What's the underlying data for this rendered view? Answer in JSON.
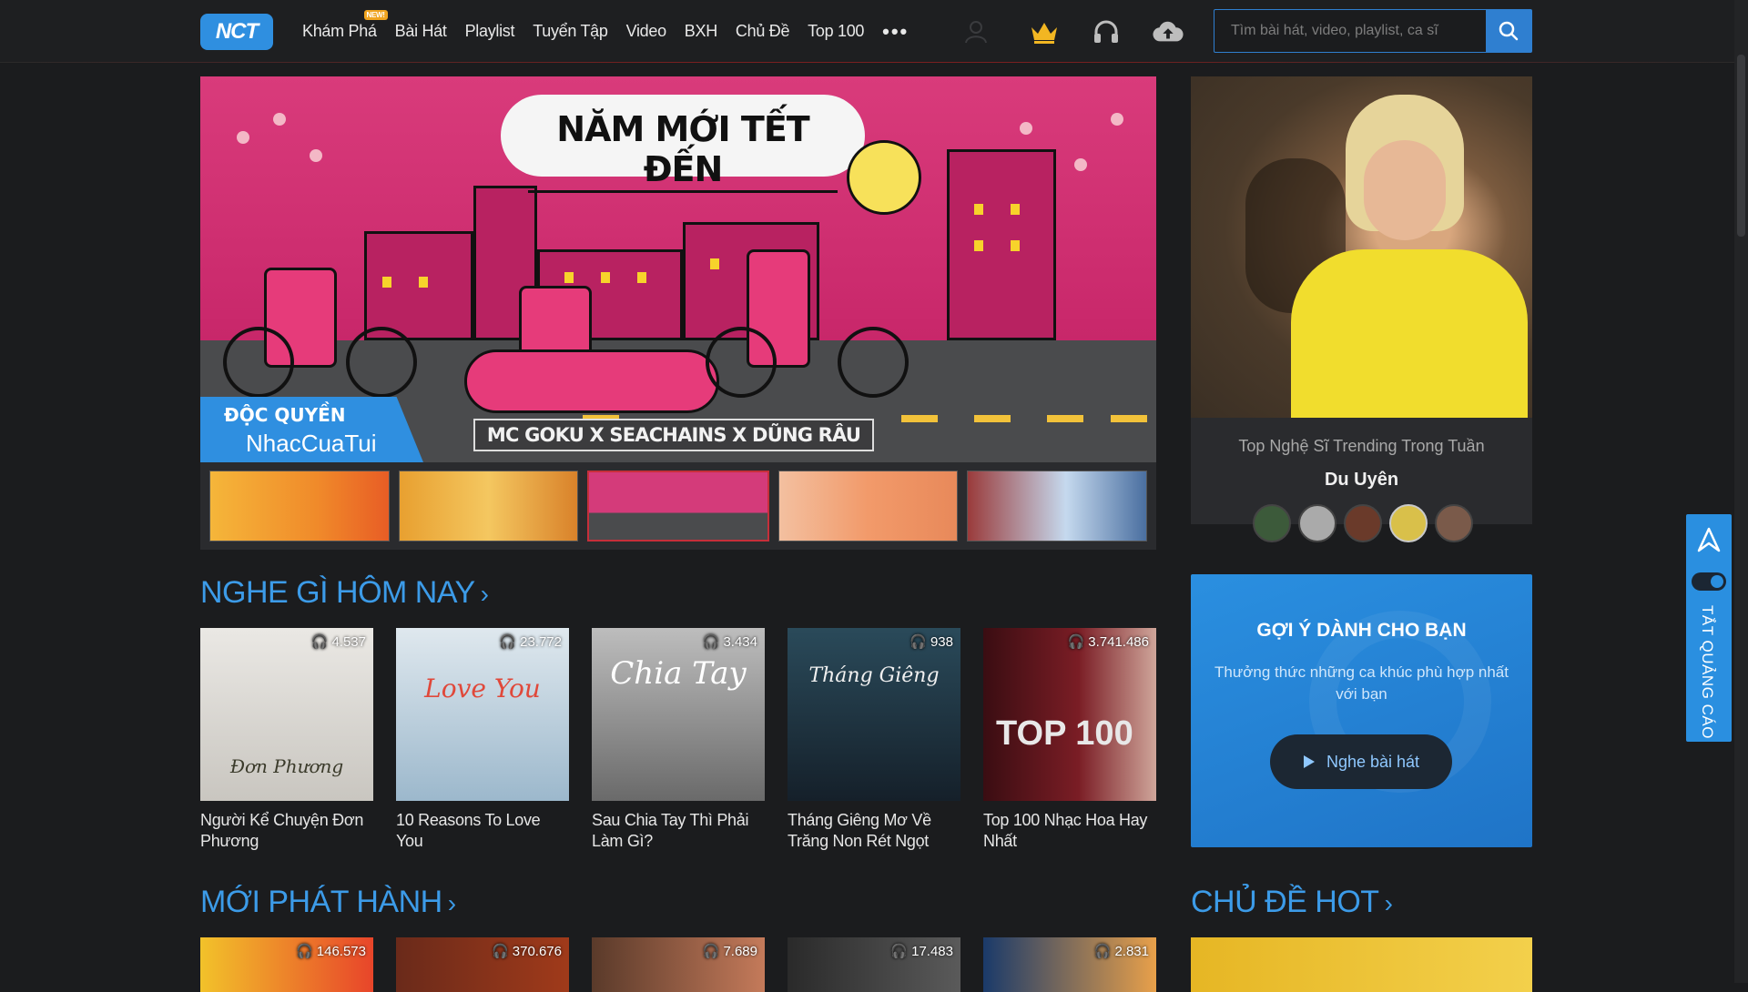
{
  "header": {
    "logo": "NCT",
    "nav": [
      {
        "label": "Khám Phá",
        "badge": "NEW!"
      },
      {
        "label": "Bài Hát"
      },
      {
        "label": "Playlist"
      },
      {
        "label": "Tuyển Tập"
      },
      {
        "label": "Video"
      },
      {
        "label": "BXH"
      },
      {
        "label": "Chủ Đề"
      },
      {
        "label": "Top 100"
      }
    ],
    "more": "•••",
    "icons": [
      "user-icon",
      "crown-icon",
      "headphones-icon",
      "cloud-upload-icon"
    ],
    "search_placeholder": "Tìm bài hát, video, playlist, ca sĩ"
  },
  "banner": {
    "title": "NĂM MỚI TẾT ĐẾN",
    "artists": "MC GOKU X SEACHAINS X DŨNG RÂU",
    "exclusive_line1": "ĐỘC QUYỀN",
    "exclusive_line2": "NhacCuaTui"
  },
  "featured_artist": {
    "caption": "Top Nghệ Sĩ Trending Trong Tuần",
    "name": "Du Uyên"
  },
  "today": {
    "title": "NGHE GÌ HÔM NAY",
    "items": [
      {
        "title": "Người Kể Chuyện Đơn Phương",
        "listens": "4.537",
        "cover_text": "Đơn Phương"
      },
      {
        "title": "10 Reasons To Love You",
        "listens": "23.772",
        "cover_text": "Love You"
      },
      {
        "title": "Sau Chia Tay Thì Phải Làm Gì?",
        "listens": "3.434",
        "cover_text": "Chia Tay"
      },
      {
        "title": "Tháng Giêng Mơ Về Trăng Non Rét Ngọt",
        "listens": "938",
        "cover_text": "Tháng Giêng"
      },
      {
        "title": "Top 100 Nhạc Hoa Hay Nhất",
        "listens": "3.741.486",
        "cover_text": "TOP 100"
      }
    ]
  },
  "new_release": {
    "title": "MỚI PHÁT HÀNH",
    "listens": [
      "146.573",
      "370.676",
      "7.689",
      "17.483",
      "2.831"
    ]
  },
  "suggest": {
    "title": "GỢI Ý DÀNH CHO BẠN",
    "subtitle": "Thưởng thức những ca khúc phù hợp nhất với bạn",
    "button": "Nghe bài hát"
  },
  "hot_topics": {
    "title": "CHỦ ĐỀ HOT"
  },
  "side_widget": {
    "label": "TẮT QUẢNG CÁO"
  },
  "colors": {
    "accent": "#3c9be8",
    "bg": "#1b1c1e"
  }
}
